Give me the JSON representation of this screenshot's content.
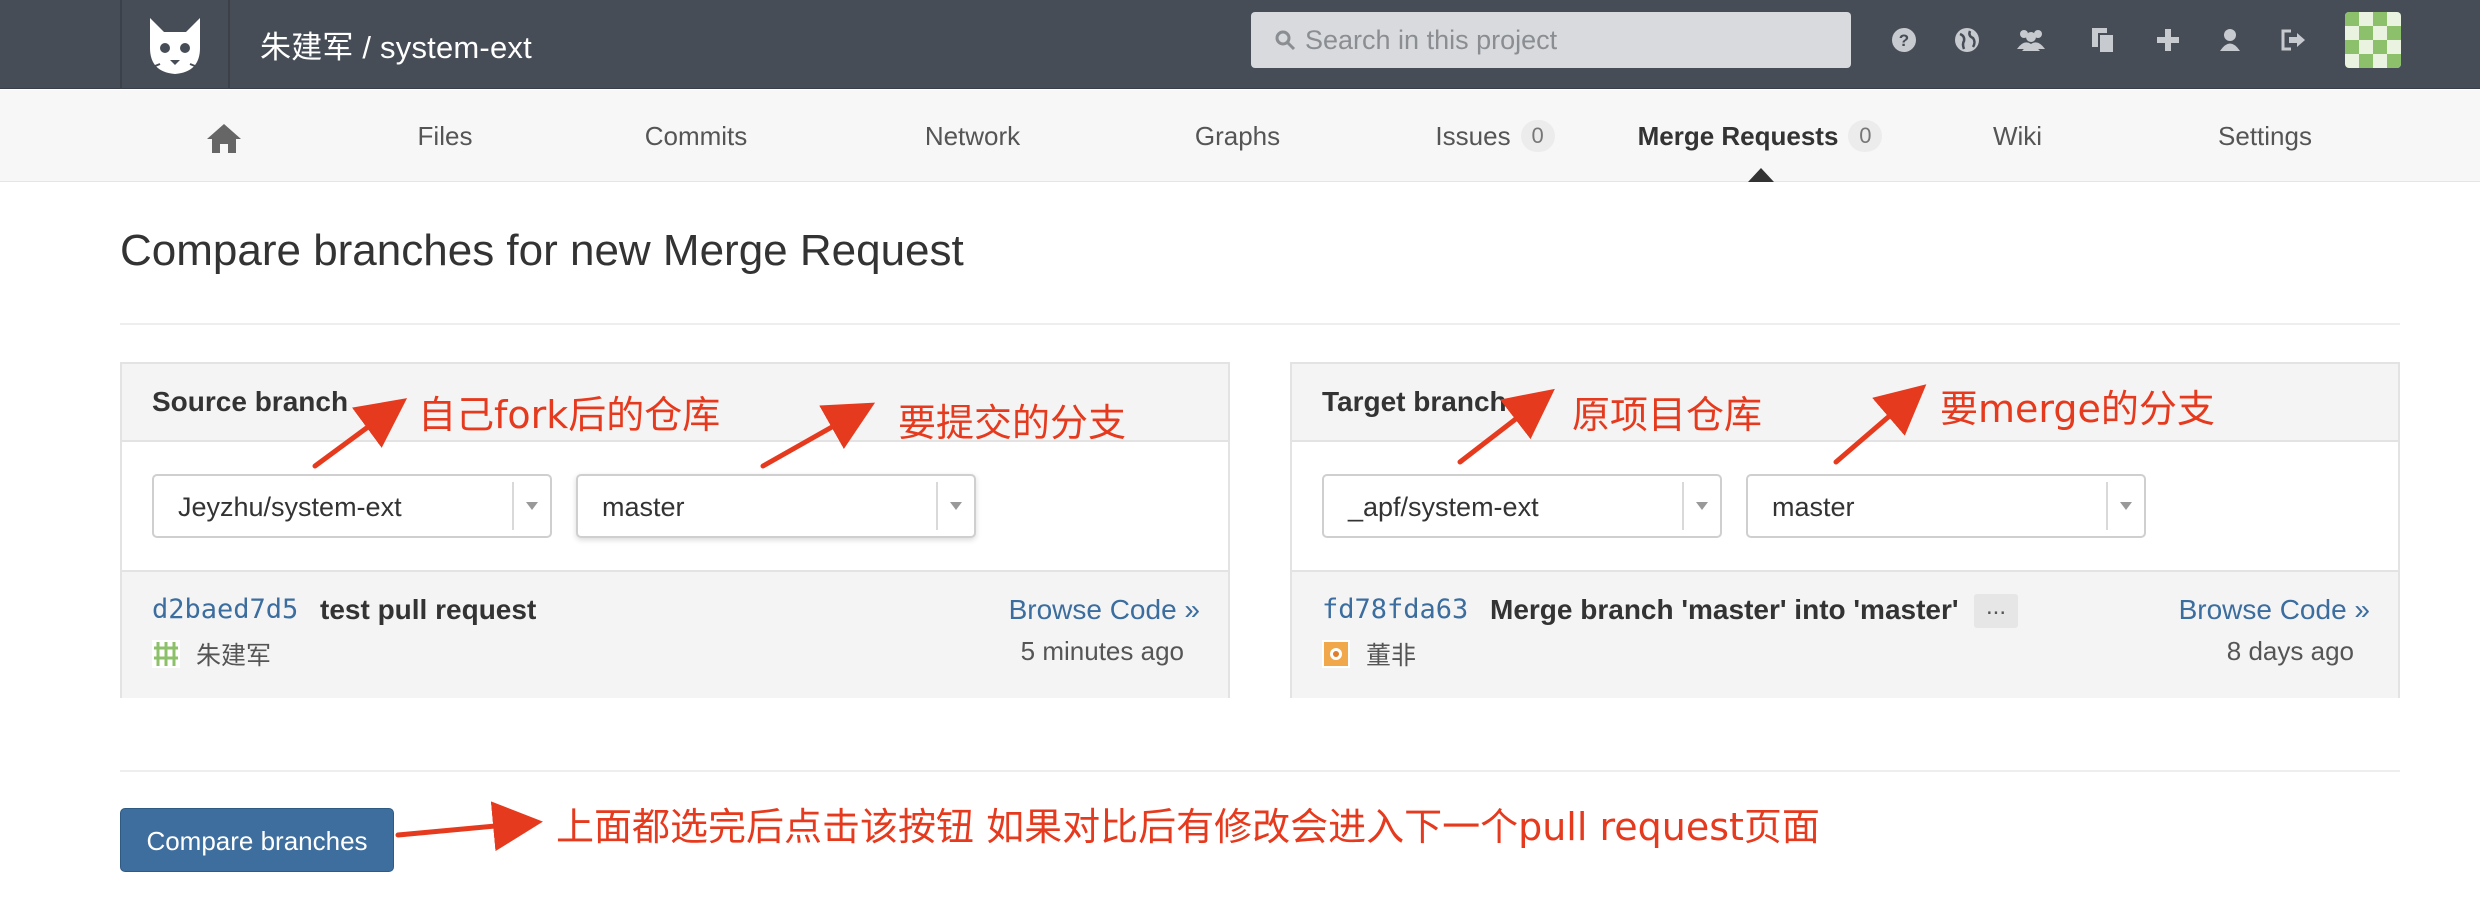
{
  "header": {
    "project_title": "朱建军 / system-ext",
    "search_placeholder": "Search in this project",
    "icons": [
      "help-icon",
      "globe-icon",
      "group-icon",
      "copy-icon",
      "plus-icon",
      "user-icon",
      "sign-out-icon"
    ]
  },
  "nav": {
    "home_icon": "home-icon",
    "tabs": [
      {
        "label": "Files"
      },
      {
        "label": "Commits"
      },
      {
        "label": "Network"
      },
      {
        "label": "Graphs"
      },
      {
        "label": "Issues",
        "count": "0"
      },
      {
        "label": "Merge Requests",
        "count": "0",
        "active": true
      },
      {
        "label": "Wiki"
      },
      {
        "label": "Settings"
      }
    ]
  },
  "page": {
    "title": "Compare branches for new Merge Request"
  },
  "source": {
    "heading": "Source branch",
    "project": "Jeyzhu/system-ext",
    "branch": "master",
    "commit": {
      "sha": "d2baed7d5",
      "message": "test pull request",
      "author": "朱建军",
      "browse": "Browse Code »",
      "time": "5 minutes ago"
    }
  },
  "target": {
    "heading": "Target branch",
    "project": "_apf/system-ext",
    "branch": "master",
    "commit": {
      "sha": "fd78fda63",
      "message": "Merge branch 'master' into 'master'",
      "more": "...",
      "author": "董非",
      "browse": "Browse Code »",
      "time": "8 days ago"
    }
  },
  "compare_button": "Compare branches",
  "annotations": {
    "source_repo": "自己fork后的仓库",
    "source_branch": "要提交的分支",
    "target_repo": "原项目仓库",
    "target_branch": "要merge的分支",
    "button_note": "上面都选完后点击该按钮 如果对比后有修改会进入下一个pull request页面"
  },
  "colors": {
    "header_bg": "#474D57",
    "link": "#3B6D9E",
    "button": "#3D6E9E",
    "annotation": "#E53A1E"
  }
}
